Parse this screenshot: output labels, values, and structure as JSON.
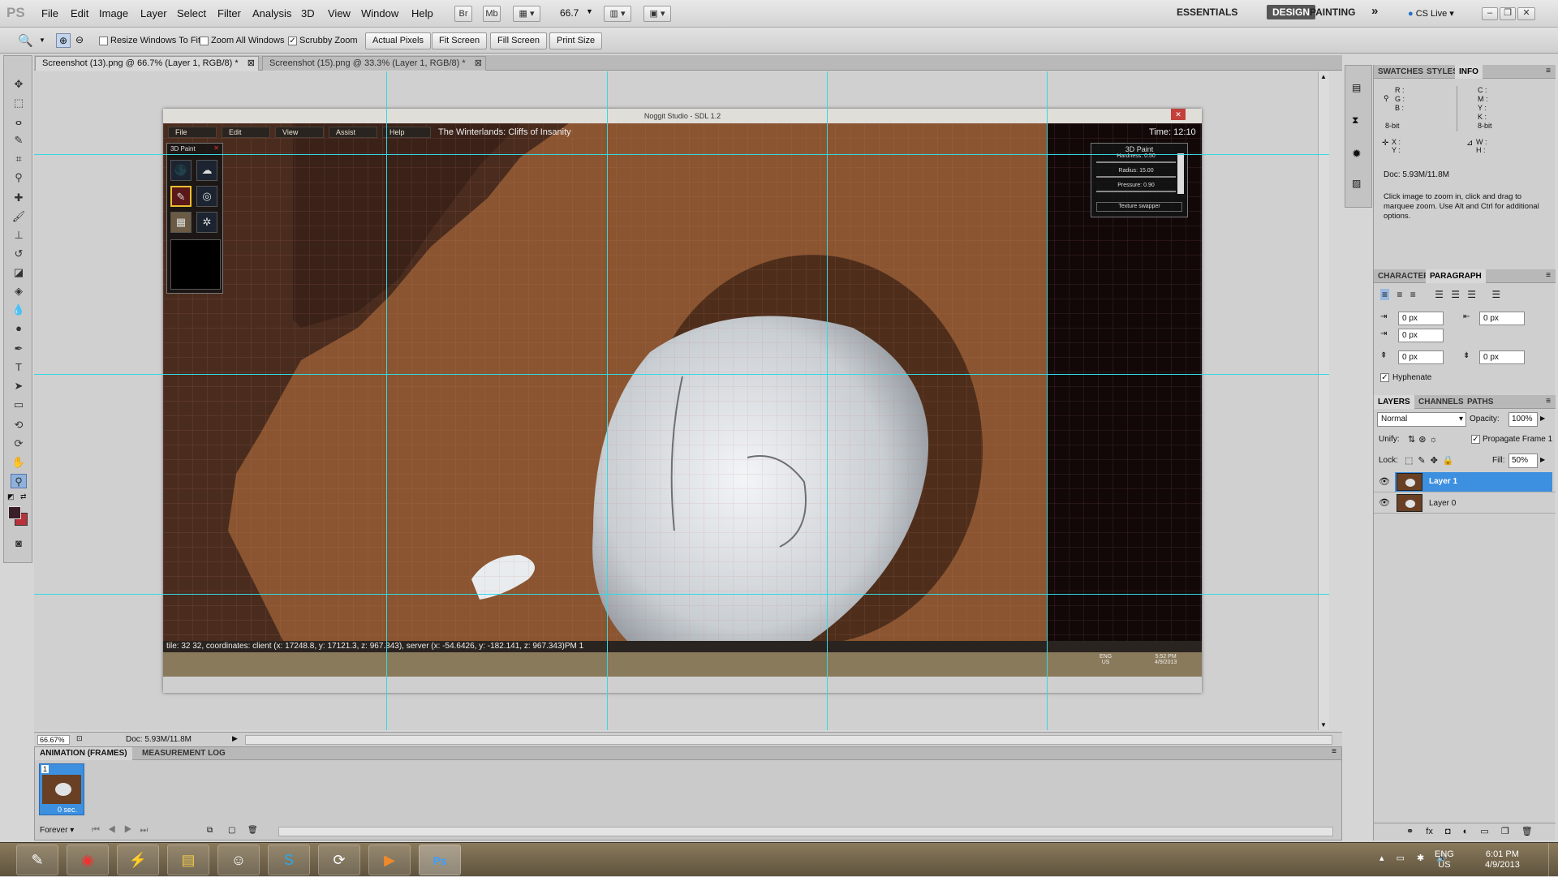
{
  "menubar": {
    "logo": "PS",
    "menus": [
      "File",
      "Edit",
      "Image",
      "Layer",
      "Select",
      "Filter",
      "Analysis",
      "3D",
      "View",
      "Window",
      "Help"
    ],
    "bridge": "Br",
    "mini_bridge": "Mb",
    "zoom": "66.7",
    "workspaces": [
      "ESSENTIALS",
      "DESIGN",
      "PAINTING"
    ],
    "cs_live": "CS Live"
  },
  "options": {
    "resize_windows": "Resize Windows To Fit",
    "zoom_all": "Zoom All Windows",
    "scrubby": "Scrubby Zoom",
    "actual_pixels": "Actual Pixels",
    "fit_screen": "Fit Screen",
    "fill_screen": "Fill Screen",
    "print_size": "Print Size"
  },
  "tabs": [
    "Screenshot (13).png @ 66.7% (Layer 1, RGB/8) *",
    "Screenshot (15).png @ 33.3% (Layer 1, RGB/8) *"
  ],
  "game": {
    "window_title": "Noggit Studio - SDL 1.2",
    "menus": [
      "File",
      "Edit",
      "View",
      "Assist",
      "Help"
    ],
    "zone": "The Winterlands: Cliffs of Insanity",
    "time": "Time: 12:10",
    "paint_title": "3D Paint",
    "paint_hardness": "Hardness: 0.50",
    "paint_radius": "Radius: 15.00",
    "paint_pressure": "Pressure: 0.90",
    "texture_swapper": "Texture swapper",
    "status": "tile: 32 32, coordinates: client (x: 17248.8, y: 17121.3, z: 967.343), server (x: -54.6426, y: -182.141, z: 967.343)PM 1",
    "inner_lang": "ENG",
    "inner_region": "US",
    "inner_time": "5:52 PM",
    "inner_date": "4/9/2013"
  },
  "status": {
    "zoom": "66.67%",
    "doc": "Doc: 5.93M/11.8M"
  },
  "animation": {
    "tabs": [
      "ANIMATION (FRAMES)",
      "MEASUREMENT LOG"
    ],
    "frame_number": "1",
    "frame_delay": "0 sec.",
    "loop": "Forever"
  },
  "info": {
    "tabs": [
      "SWATCHES",
      "STYLES",
      "INFO"
    ],
    "r": "R :",
    "g": "G :",
    "b": "B :",
    "c": "C :",
    "m": "M :",
    "y": "Y :",
    "k": "K :",
    "bit_left": "8-bit",
    "bit_right": "8-bit",
    "x": "X :",
    "y2": "Y :",
    "w": "W :",
    "h": "H :",
    "doc": "Doc: 5.93M/11.8M",
    "hint": "Click image to zoom in, click and drag to marquee zoom.  Use Alt and Ctrl for additional options."
  },
  "paragraph": {
    "tabs": [
      "CHARACTER",
      "PARAGRAPH"
    ],
    "indent_left": "0 px",
    "indent_right": "0 px",
    "indent_first": "0 px",
    "space_before": "0 px",
    "space_after": "0 px",
    "hyphenate": "Hyphenate"
  },
  "layers": {
    "tabs": [
      "LAYERS",
      "CHANNELS",
      "PATHS"
    ],
    "blend": "Normal",
    "opacity_label": "Opacity:",
    "opacity": "100%",
    "unify": "Unify:",
    "propagate": "Propagate Frame 1",
    "lock": "Lock:",
    "fill_label": "Fill:",
    "fill": "50%",
    "items": [
      "Layer 1",
      "Layer 0"
    ]
  },
  "taskbar": {
    "lang": "ENG",
    "region": "US",
    "time": "6:01 PM",
    "date": "4/9/2013",
    "apps": [
      "photoshop-notepad",
      "chrome",
      "utility",
      "explorer",
      "people",
      "skype",
      "network",
      "media",
      "photoshop"
    ]
  },
  "colors": {
    "accent": "#3d8fe0",
    "guide": "#35d8e2",
    "foreground": "#3a1f28",
    "background": "#b9323a"
  }
}
